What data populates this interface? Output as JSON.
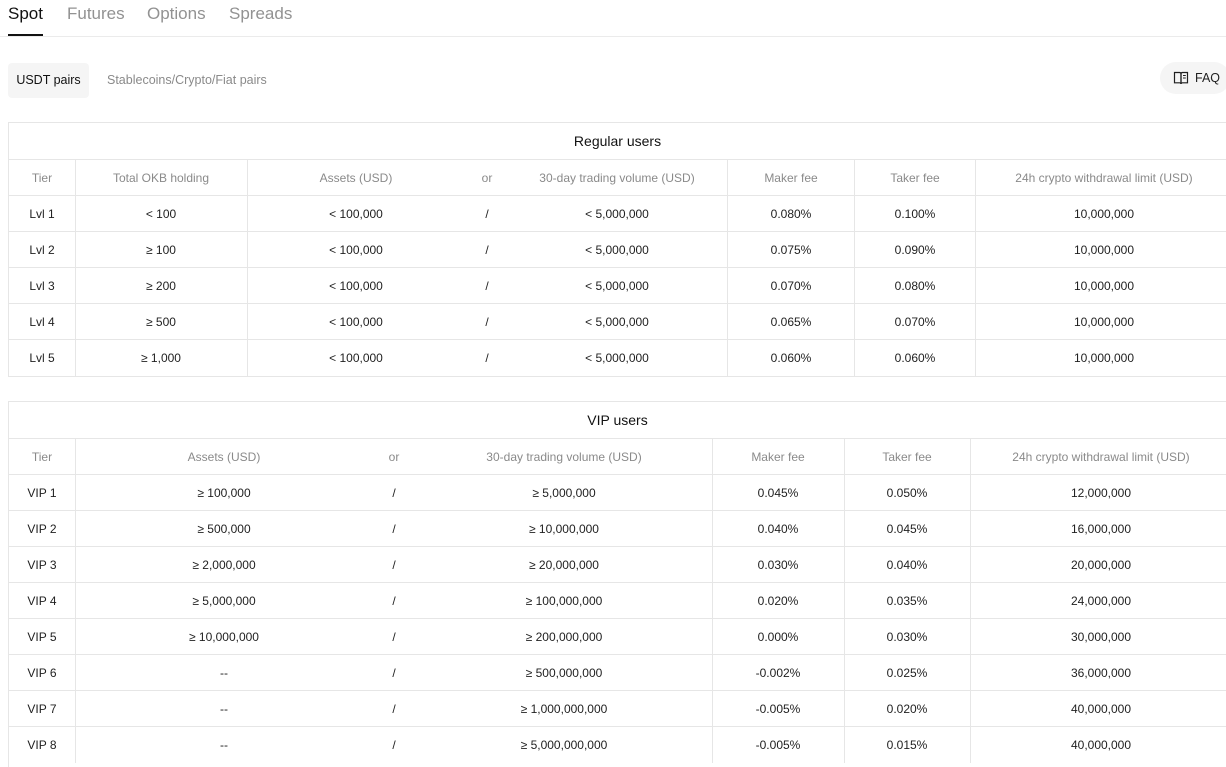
{
  "tabs": [
    {
      "label": "Spot",
      "active": true
    },
    {
      "label": "Futures",
      "active": false
    },
    {
      "label": "Options",
      "active": false
    },
    {
      "label": "Spreads",
      "active": false
    }
  ],
  "pair_tabs": {
    "active": "USDT pairs",
    "inactive": "Stablecoins/Crypto/Fiat pairs"
  },
  "faq": {
    "label": "FAQ",
    "icon": "book-icon"
  },
  "regular": {
    "title": "Regular users",
    "headers": [
      "Tier",
      "Total OKB holding",
      "Assets (USD)",
      "or",
      "30-day trading volume (USD)",
      "Maker fee",
      "Taker fee",
      "24h crypto withdrawal limit (USD)"
    ],
    "rows": [
      [
        "Lvl 1",
        "< 100",
        "< 100,000",
        "/",
        "< 5,000,000",
        "0.080%",
        "0.100%",
        "10,000,000"
      ],
      [
        "Lvl 2",
        "≥ 100",
        "< 100,000",
        "/",
        "< 5,000,000",
        "0.075%",
        "0.090%",
        "10,000,000"
      ],
      [
        "Lvl 3",
        "≥ 200",
        "< 100,000",
        "/",
        "< 5,000,000",
        "0.070%",
        "0.080%",
        "10,000,000"
      ],
      [
        "Lvl 4",
        "≥ 500",
        "< 100,000",
        "/",
        "< 5,000,000",
        "0.065%",
        "0.070%",
        "10,000,000"
      ],
      [
        "Lvl 5",
        "≥ 1,000",
        "< 100,000",
        "/",
        "< 5,000,000",
        "0.060%",
        "0.060%",
        "10,000,000"
      ]
    ]
  },
  "vip": {
    "title": "VIP users",
    "headers": [
      "Tier",
      "Assets (USD)",
      "or",
      "30-day trading volume (USD)",
      "Maker fee",
      "Taker fee",
      "24h crypto withdrawal limit (USD)"
    ],
    "rows": [
      [
        "VIP 1",
        "≥ 100,000",
        "/",
        "≥ 5,000,000",
        "0.045%",
        "0.050%",
        "12,000,000"
      ],
      [
        "VIP 2",
        "≥ 500,000",
        "/",
        "≥ 10,000,000",
        "0.040%",
        "0.045%",
        "16,000,000"
      ],
      [
        "VIP 3",
        "≥ 2,000,000",
        "/",
        "≥ 20,000,000",
        "0.030%",
        "0.040%",
        "20,000,000"
      ],
      [
        "VIP 4",
        "≥ 5,000,000",
        "/",
        "≥ 100,000,000",
        "0.020%",
        "0.035%",
        "24,000,000"
      ],
      [
        "VIP 5",
        "≥ 10,000,000",
        "/",
        "≥ 200,000,000",
        "0.000%",
        "0.030%",
        "30,000,000"
      ],
      [
        "VIP 6",
        "--",
        "/",
        "≥ 500,000,000",
        "-0.002%",
        "0.025%",
        "36,000,000"
      ],
      [
        "VIP 7",
        "--",
        "/",
        "≥ 1,000,000,000",
        "-0.005%",
        "0.020%",
        "40,000,000"
      ],
      [
        "VIP 8",
        "--",
        "/",
        "≥ 5,000,000,000",
        "-0.005%",
        "0.015%",
        "40,000,000"
      ]
    ]
  }
}
